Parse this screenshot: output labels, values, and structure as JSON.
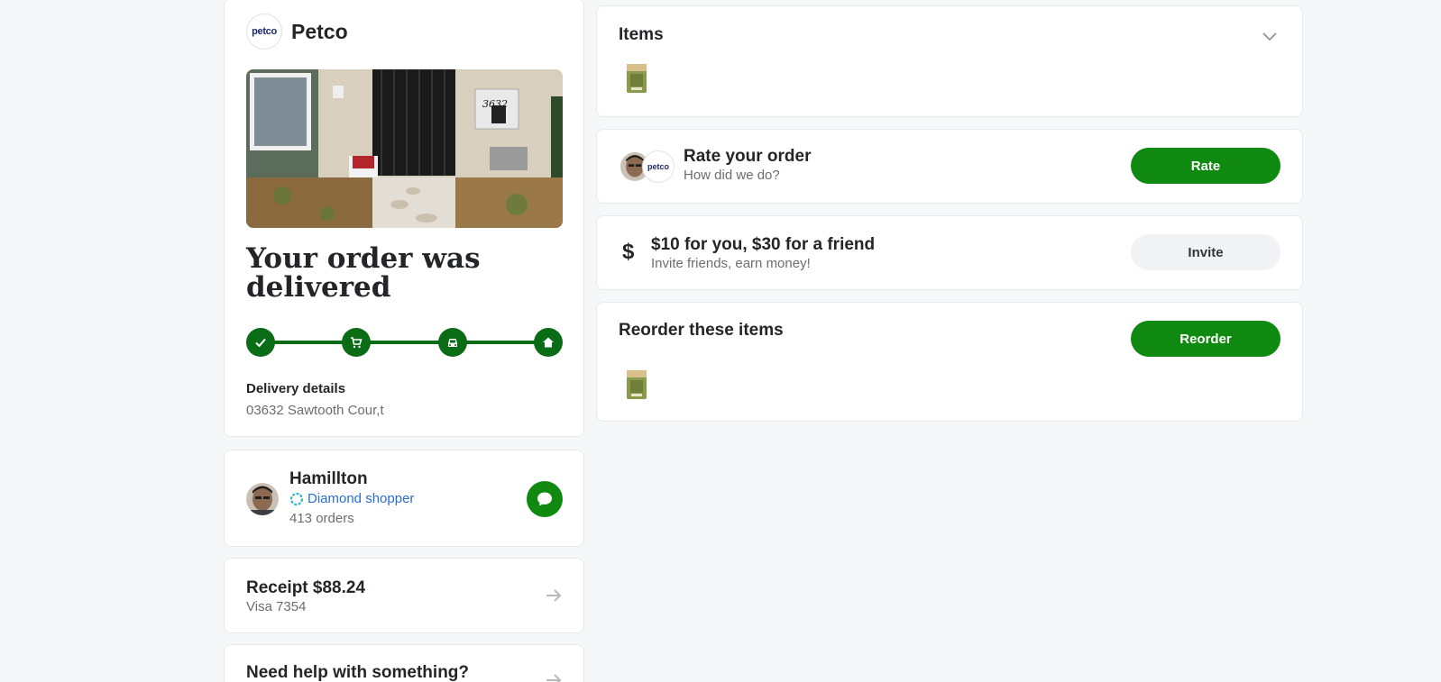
{
  "store": {
    "logo_text": "petco",
    "name": "Petco"
  },
  "order": {
    "title": "Your order was delivered",
    "progress_steps": [
      "check-icon",
      "cart-icon",
      "car-icon",
      "home-icon"
    ],
    "delivery_label": "Delivery details",
    "delivery_address": "03632 Sawtooth Cour,t",
    "photo_house_number": "3632"
  },
  "shopper": {
    "name": "Hamillton",
    "tier": "Diamond shopper",
    "orders": "413 orders"
  },
  "receipt": {
    "title": "Receipt $88.24",
    "card": "Visa 7354"
  },
  "help": {
    "title": "Need help with something?"
  },
  "items": {
    "title": "Items"
  },
  "rate": {
    "logo_text": "petco",
    "title": "Rate your order",
    "subtitle": "How did we do?",
    "button": "Rate"
  },
  "invite": {
    "icon": "$",
    "title": "$10 for you, $30 for a friend",
    "subtitle": "Invite friends, earn money!",
    "button": "Invite"
  },
  "reorder": {
    "title": "Reorder these items",
    "button": "Reorder"
  },
  "colors": {
    "brand_green": "#108910",
    "progress_green": "#0a6c14",
    "link_blue": "#2a6fcf",
    "background": "#f6f7f8"
  }
}
